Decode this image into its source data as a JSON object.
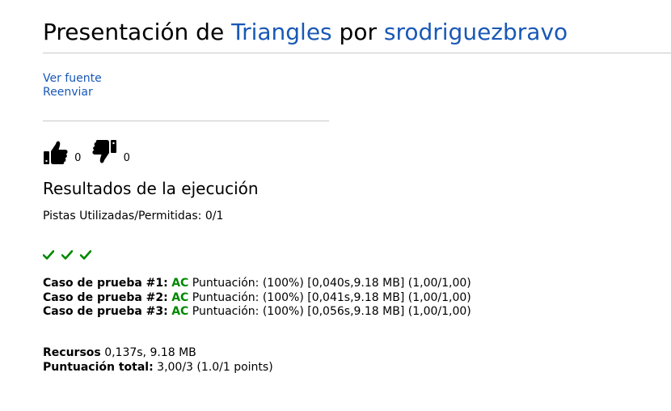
{
  "header": {
    "prefix": "Presentación de",
    "problem": "Triangles",
    "connector": "por",
    "user": "srodriguezbravo"
  },
  "actions": {
    "view_source": "Ver fuente",
    "resubmit": "Reenviar"
  },
  "votes": {
    "up_count": "0",
    "down_count": "0",
    "up_icon": "thumbs-up-icon",
    "down_icon": "thumbs-down-icon"
  },
  "results": {
    "title": "Resultados de la ejecución",
    "hints_label": "Pistas Utilizadas/Permitidas:",
    "hints_value": "0/1",
    "check_icon": "check-icon",
    "check_color": "#008800",
    "cases": [
      {
        "label": "Caso de prueba #1:",
        "status": "AC",
        "detail": "Puntuación: (100%) [0,040s,9.18 MB] (1,00/1,00)"
      },
      {
        "label": "Caso de prueba #2:",
        "status": "AC",
        "detail": "Puntuación: (100%) [0,041s,9.18 MB] (1,00/1,00)"
      },
      {
        "label": "Caso de prueba #3:",
        "status": "AC",
        "detail": "Puntuación: (100%) [0,056s,9.18 MB] (1,00/1,00)"
      }
    ]
  },
  "summary": {
    "resources_label": "Recursos",
    "resources_value": "0,137s, 9.18 MB",
    "total_label": "Puntuación total:",
    "total_value": "3,00/3 (1.0/1 points)"
  },
  "colors": {
    "link": "#1958b7",
    "accepted": "#008800"
  }
}
